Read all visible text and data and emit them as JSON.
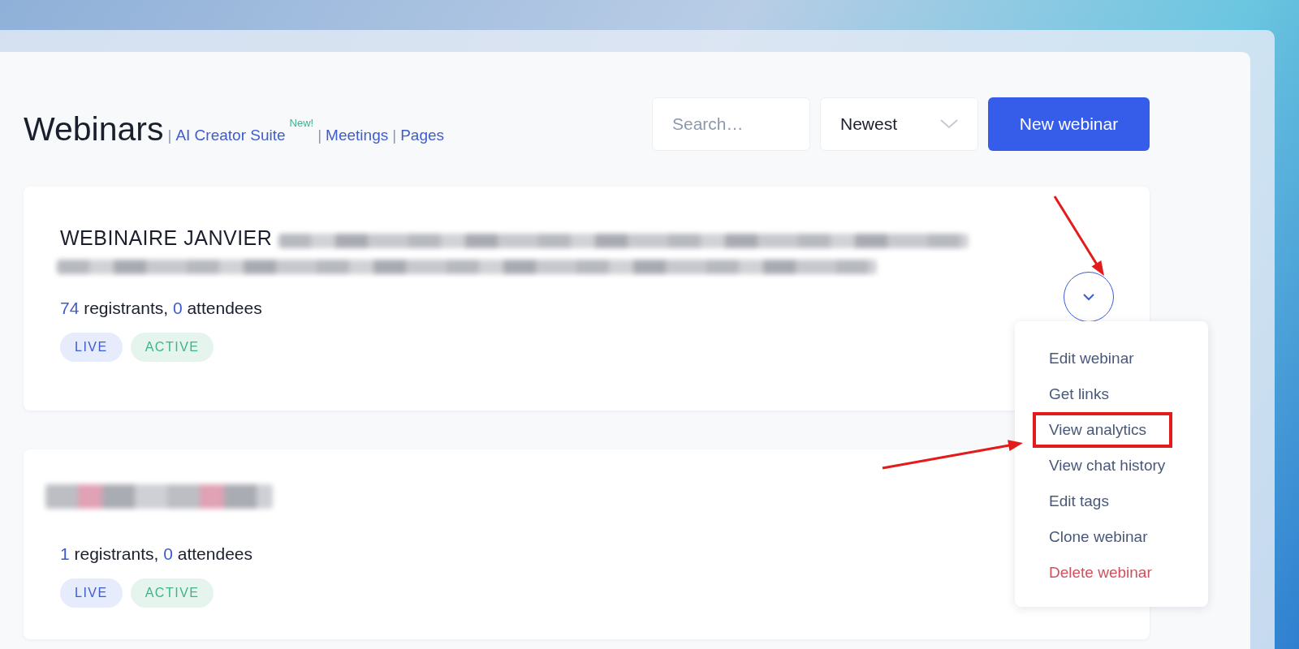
{
  "header": {
    "title": "Webinars",
    "nav_links": [
      {
        "separator": "|",
        "label": "AI Creator Suite",
        "badge": "New!"
      },
      {
        "separator": "|",
        "label": "Meetings"
      },
      {
        "separator": "|",
        "label": "Pages"
      }
    ]
  },
  "toolbar": {
    "search": {
      "placeholder": "Search…"
    },
    "sort": {
      "value": "Newest"
    },
    "new_button": "New webinar"
  },
  "webinars": [
    {
      "title": "WEBINAIRE JANVIER",
      "registrants": "74",
      "registrants_label": "registrants,",
      "attendees": "0",
      "attendees_label": "attendees",
      "tags": [
        {
          "label": "LIVE",
          "kind": "live"
        },
        {
          "label": "ACTIVE",
          "kind": "active"
        }
      ],
      "menu_expanded": true,
      "menu": [
        {
          "label": "Edit webinar",
          "kind": "normal",
          "highlighted": false
        },
        {
          "label": "Get links",
          "kind": "normal",
          "highlighted": false
        },
        {
          "label": "View analytics",
          "kind": "normal",
          "highlighted": true
        },
        {
          "label": "View chat history",
          "kind": "normal",
          "highlighted": false
        },
        {
          "label": "Edit tags",
          "kind": "normal",
          "highlighted": false
        },
        {
          "label": "Clone webinar",
          "kind": "normal",
          "highlighted": false
        },
        {
          "label": "Delete webinar",
          "kind": "danger",
          "highlighted": false
        }
      ]
    },
    {
      "registrants": "1",
      "registrants_label": "registrants,",
      "attendees": "0",
      "attendees_label": "attendees",
      "tags": [
        {
          "label": "LIVE",
          "kind": "live"
        },
        {
          "label": "ACTIVE",
          "kind": "active"
        }
      ],
      "menu_expanded": false
    }
  ]
}
